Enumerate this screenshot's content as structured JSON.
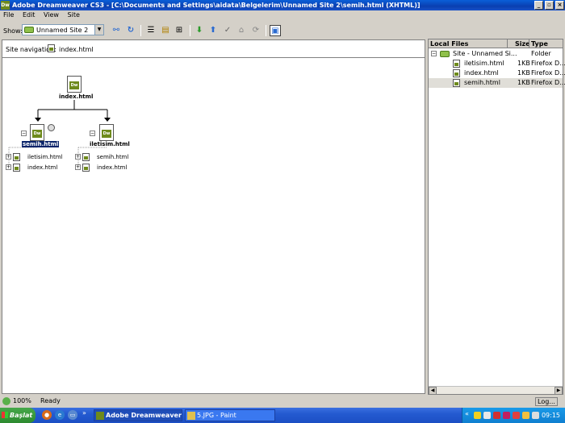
{
  "window": {
    "title": "Adobe Dreamweaver CS3 - [C:\\Documents and Settings\\aidata\\Belgelerim\\Unnamed Site 2\\semih.html (XHTML)]",
    "app_icon": "Dw",
    "minimize": "_",
    "restore": "▫",
    "close": "×"
  },
  "menu": {
    "items": [
      "File",
      "Edit",
      "View",
      "Site"
    ]
  },
  "toolbar": {
    "show_label": "Show:",
    "site_value": "Unnamed Site 2",
    "icons": [
      "connect-icon",
      "refresh-icon",
      "site-files-icon",
      "testing-server-icon",
      "site-map-icon",
      "get-icon",
      "put-icon",
      "check-out-icon",
      "check-in-icon",
      "synchronize-icon",
      "expand-icon"
    ]
  },
  "site_navigation": {
    "label": "Site navigation:",
    "file": "index.html"
  },
  "site_map": {
    "root": {
      "label": "index.html"
    },
    "nodes": [
      {
        "label": "semih.html",
        "selected": true,
        "children": [
          "iletisim.html",
          "index.html"
        ]
      },
      {
        "label": "iletisim.html",
        "selected": false,
        "children": [
          "semih.html",
          "index.html"
        ]
      }
    ]
  },
  "files_panel": {
    "columns": [
      "Local Files",
      "Size",
      "Type"
    ],
    "rows": [
      {
        "name": "Site - Unnamed Si...",
        "size": "",
        "type": "Folder",
        "kind": "folder"
      },
      {
        "name": "iletisim.html",
        "size": "1KB",
        "type": "Firefox D...",
        "kind": "file"
      },
      {
        "name": "index.html",
        "size": "1KB",
        "type": "Firefox D...",
        "kind": "file"
      },
      {
        "name": "semih.html",
        "size": "1KB",
        "type": "Firefox D...",
        "kind": "file",
        "selected": true
      }
    ],
    "expand_glyph": "−"
  },
  "statusbar": {
    "zoom": "100%",
    "status": "Ready",
    "log_button": "Log..."
  },
  "taskbar": {
    "start": "Başlat",
    "overflow": "»",
    "tasks": [
      {
        "label": "Adobe Dreamweaver ...",
        "active": true
      },
      {
        "label": "5.JPG - Paint",
        "active": false
      }
    ],
    "tray_expand": "«",
    "clock": "09:15"
  },
  "colors": {
    "titlebar": "#0a3fb0",
    "selection": "#0a246a",
    "dw_green": "#6e8a1c",
    "taskbar": "#245ad0"
  }
}
